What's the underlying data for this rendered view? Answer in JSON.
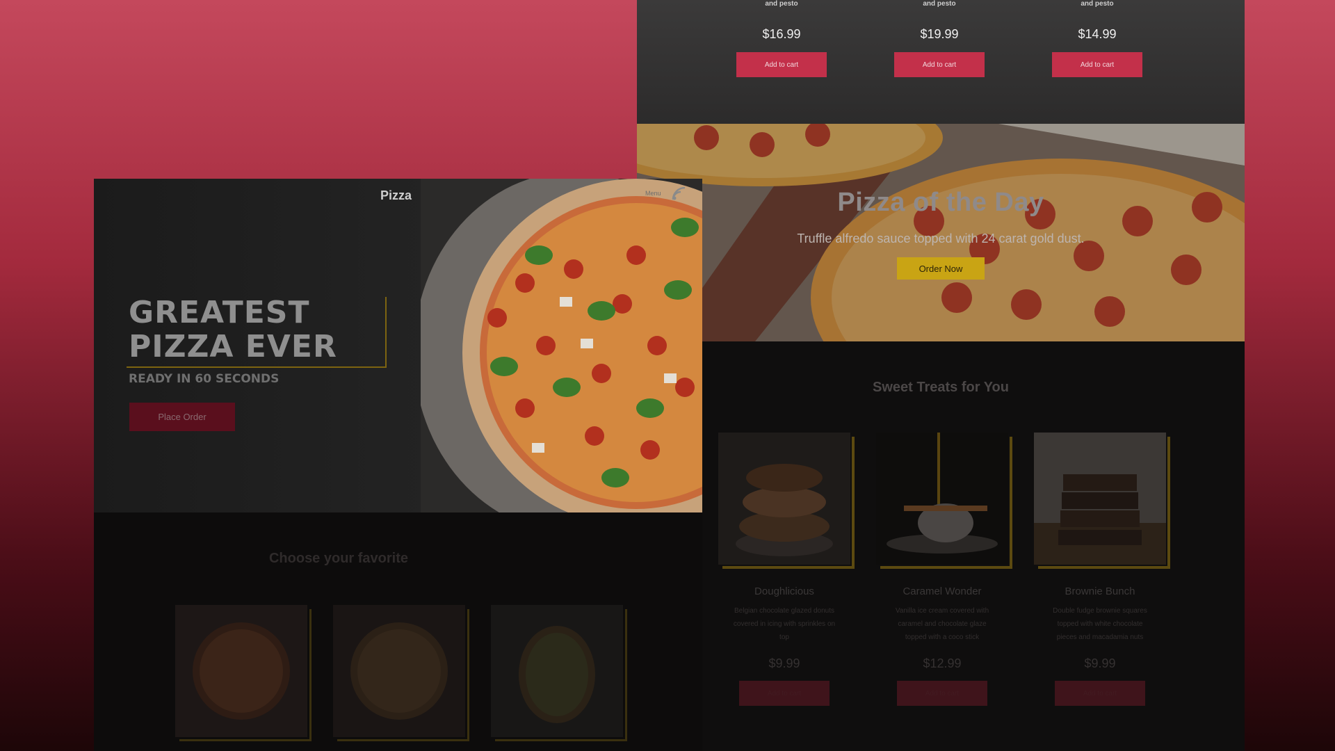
{
  "top_products": [
    {
      "subtitle": "and pesto",
      "price": "$16.99",
      "button": "Add to cart"
    },
    {
      "subtitle": "and pesto",
      "price": "$19.99",
      "button": "Add to cart"
    },
    {
      "subtitle": "and pesto",
      "price": "$14.99",
      "button": "Add to cart"
    }
  ],
  "pizza_of_day": {
    "title": "Pizza of the Day",
    "subtitle": "Truffle alfredo sauce topped with 24 carat gold dust.",
    "button": "Order Now"
  },
  "sweets": {
    "title": "Sweet Treats for You",
    "items": [
      {
        "name": "Doughlicious",
        "desc": "Belgian chocolate glazed donuts covered in icing with sprinkles on top",
        "price": "$9.99",
        "button": "Add to cart"
      },
      {
        "name": "Caramel Wonder",
        "desc": "Vanilla ice cream covered with caramel and chocolate glaze topped with a coco stick",
        "price": "$12.99",
        "button": "Add to cart"
      },
      {
        "name": "Brownie Bunch",
        "desc": "Double fudge brownie squares topped with white chocolate pieces and macadamia nuts",
        "price": "$9.99",
        "button": "Add to cart"
      }
    ]
  },
  "hero": {
    "brand": "Pizza",
    "menu": "Menu",
    "headline_line1": "GREATEST",
    "headline_line2": "PIZZA EVER",
    "subheadline": "READY IN 60 SECONDS",
    "button": "Place Order"
  },
  "favorites": {
    "title": "Choose your favorite"
  },
  "colors": {
    "accent_red": "#c3304a",
    "accent_gold": "#c9a414",
    "background_gradient_top": "#c4485c"
  },
  "icons": [
    "wifi-signal-icon"
  ]
}
